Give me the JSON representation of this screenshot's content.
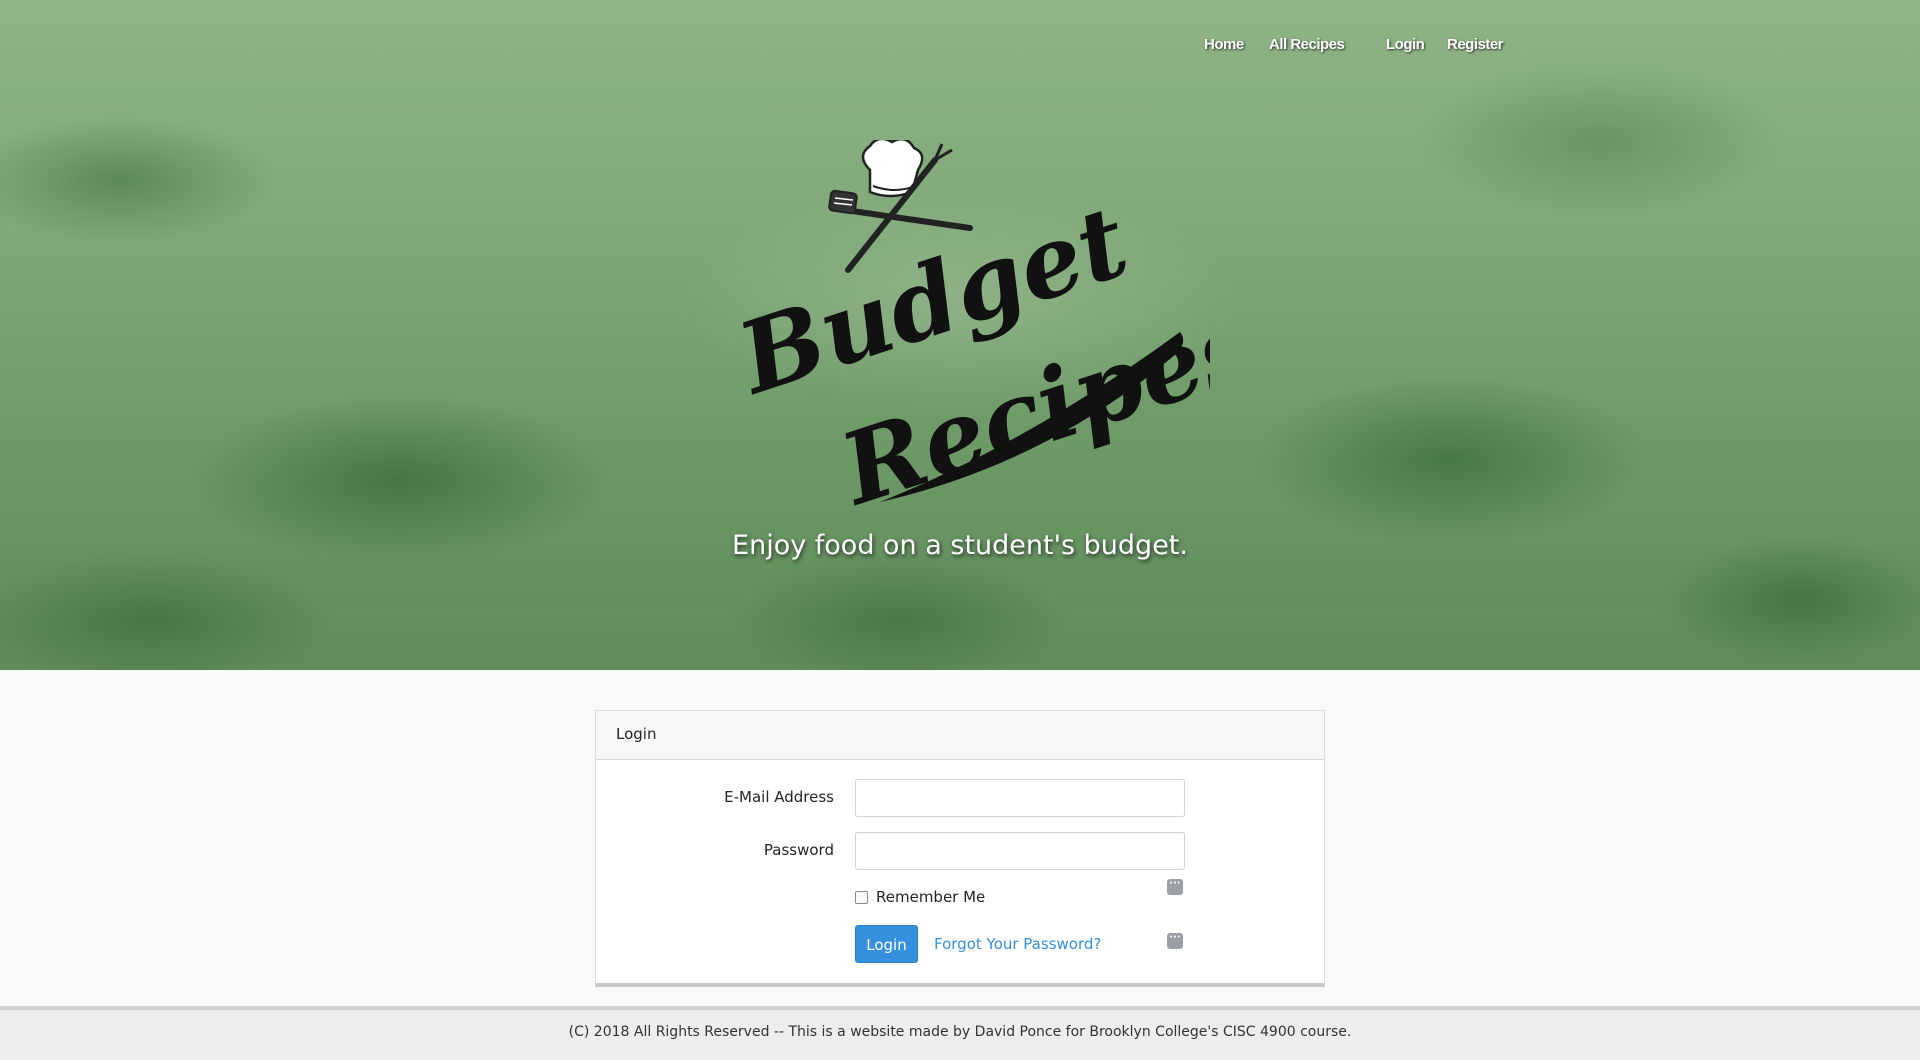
{
  "nav": {
    "home": "Home",
    "all_recipes": "All Recipes",
    "login": "Login",
    "register": "Register"
  },
  "hero": {
    "logo_line1": "Budget",
    "logo_line2": "Recipes",
    "tagline": "Enjoy food on a student's budget."
  },
  "login_card": {
    "header": "Login",
    "email_label": "E-Mail Address",
    "email_value": "",
    "password_label": "Password",
    "password_value": "",
    "remember_label": "Remember Me",
    "remember_checked": false,
    "login_button": "Login",
    "forgot_link": "Forgot Your Password?"
  },
  "footer": {
    "text": "(C) 2018 All Rights Reserved -- This is a website made by David Ponce for Brooklyn College's CISC 4900 course."
  },
  "colors": {
    "primary": "#3490dc",
    "hero_green": "#7fa878"
  }
}
